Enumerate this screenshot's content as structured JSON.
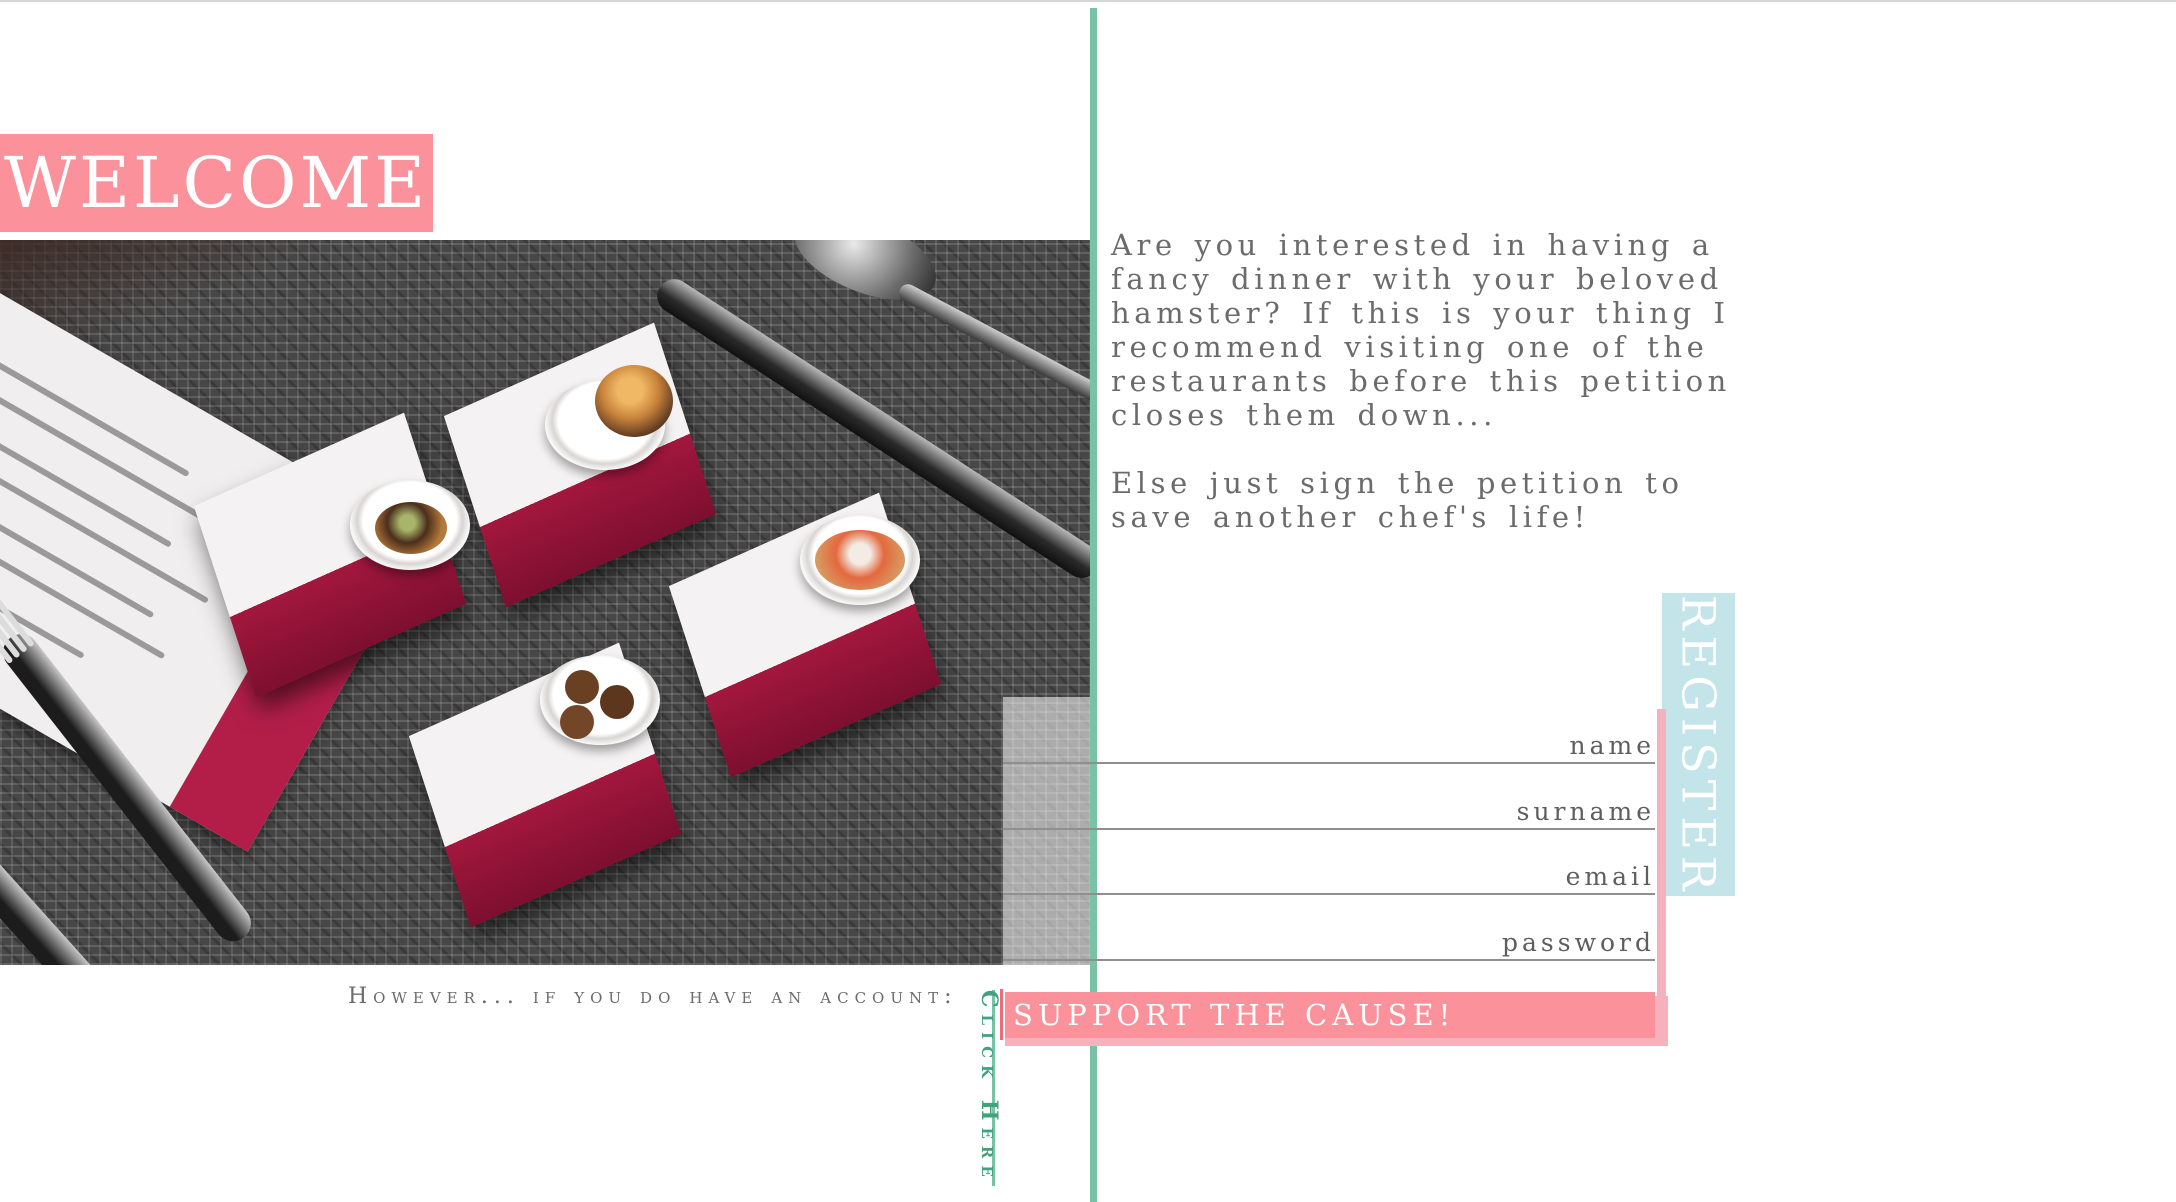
{
  "welcome": {
    "title": "WELCOME!"
  },
  "photo": {
    "alt": "miniature tasting menu dishes"
  },
  "intro": {
    "paragraph1": "Are you interested in having a fancy dinner with your beloved hamster? If this is your thing I recommend visiting one of the restaurants before this petition closes them down...",
    "paragraph2": "Else just sign the petition to save another chef's life!"
  },
  "register": {
    "tab_label": "REGISTER",
    "fields": [
      {
        "label": "name",
        "value": ""
      },
      {
        "label": "surname",
        "value": ""
      },
      {
        "label": "email",
        "value": ""
      },
      {
        "label": "password",
        "value": ""
      }
    ],
    "submit_label": "SUPPORT THE CAUSE!"
  },
  "login": {
    "prompt": "However... if you do have an account:",
    "link_label": "Click Here"
  },
  "colors": {
    "accent_pink": "#fa919b",
    "accent_green": "#78c2a6",
    "accent_teal": "#c3e4e8",
    "link_green": "#42a27d"
  }
}
